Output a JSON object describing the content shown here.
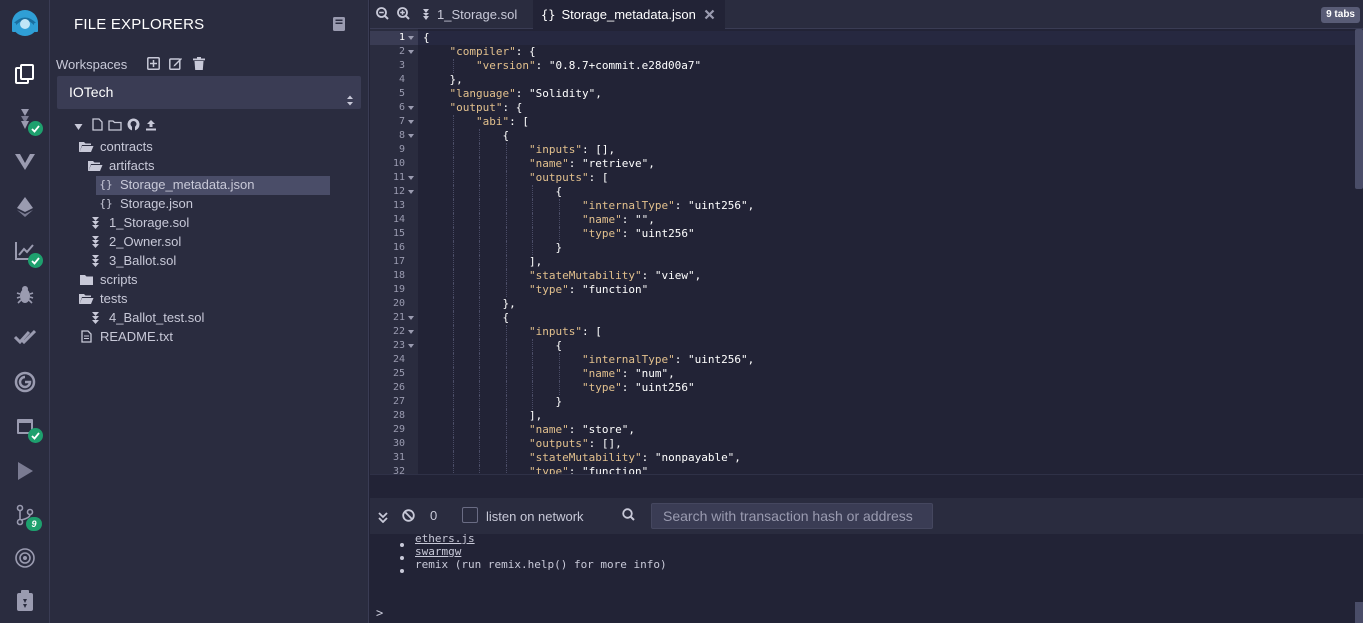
{
  "explorer": {
    "title": "FILE EXPLORERS",
    "workspaces_label": "Workspaces",
    "workspace_selected": "IOTech",
    "tree": [
      {
        "label": "contracts",
        "type": "folder-open",
        "depth": 0
      },
      {
        "label": "artifacts",
        "type": "folder-open",
        "depth": 1
      },
      {
        "label": "Storage_metadata.json",
        "type": "json",
        "depth": 2,
        "selected": true
      },
      {
        "label": "Storage.json",
        "type": "json",
        "depth": 2
      },
      {
        "label": "1_Storage.sol",
        "type": "sol",
        "depth": 1
      },
      {
        "label": "2_Owner.sol",
        "type": "sol",
        "depth": 1
      },
      {
        "label": "3_Ballot.sol",
        "type": "sol",
        "depth": 1
      },
      {
        "label": "scripts",
        "type": "folder",
        "depth": 0
      },
      {
        "label": "tests",
        "type": "folder-open",
        "depth": 0
      },
      {
        "label": "4_Ballot_test.sol",
        "type": "sol",
        "depth": 1
      },
      {
        "label": "README.txt",
        "type": "file",
        "depth": 0
      }
    ]
  },
  "iconbar": {
    "git_badge": "9"
  },
  "tabs": [
    {
      "label": "1_Storage.sol",
      "icon": "solidity-icon",
      "active": false
    },
    {
      "label": "Storage_metadata.json",
      "icon": "json-icon",
      "active": true
    }
  ],
  "tabs_count": "9 tabs",
  "code_lines": [
    {
      "n": "1",
      "fold": true,
      "ind": 0,
      "text": "{"
    },
    {
      "n": "2",
      "fold": true,
      "ind": 1,
      "k": "\"compiler\"",
      "text": ": {"
    },
    {
      "n": "3",
      "fold": false,
      "ind": 2,
      "k": "\"version\"",
      "text": ": \"0.8.7+commit.e28d00a7\""
    },
    {
      "n": "4",
      "fold": false,
      "ind": 1,
      "text": "},"
    },
    {
      "n": "5",
      "fold": false,
      "ind": 1,
      "k": "\"language\"",
      "text": ": \"Solidity\","
    },
    {
      "n": "6",
      "fold": true,
      "ind": 1,
      "k": "\"output\"",
      "text": ": {"
    },
    {
      "n": "7",
      "fold": true,
      "ind": 2,
      "k": "\"abi\"",
      "text": ": ["
    },
    {
      "n": "8",
      "fold": true,
      "ind": 3,
      "text": "{"
    },
    {
      "n": "9",
      "fold": false,
      "ind": 4,
      "k": "\"inputs\"",
      "text": ": [],"
    },
    {
      "n": "10",
      "fold": false,
      "ind": 4,
      "k": "\"name\"",
      "text": ": \"retrieve\","
    },
    {
      "n": "11",
      "fold": true,
      "ind": 4,
      "k": "\"outputs\"",
      "text": ": ["
    },
    {
      "n": "12",
      "fold": true,
      "ind": 5,
      "text": "{"
    },
    {
      "n": "13",
      "fold": false,
      "ind": 6,
      "k": "\"internalType\"",
      "text": ": \"uint256\","
    },
    {
      "n": "14",
      "fold": false,
      "ind": 6,
      "k": "\"name\"",
      "text": ": \"\","
    },
    {
      "n": "15",
      "fold": false,
      "ind": 6,
      "k": "\"type\"",
      "text": ": \"uint256\""
    },
    {
      "n": "16",
      "fold": false,
      "ind": 5,
      "text": "}"
    },
    {
      "n": "17",
      "fold": false,
      "ind": 4,
      "text": "],"
    },
    {
      "n": "18",
      "fold": false,
      "ind": 4,
      "k": "\"stateMutability\"",
      "text": ": \"view\","
    },
    {
      "n": "19",
      "fold": false,
      "ind": 4,
      "k": "\"type\"",
      "text": ": \"function\""
    },
    {
      "n": "20",
      "fold": false,
      "ind": 3,
      "text": "},"
    },
    {
      "n": "21",
      "fold": true,
      "ind": 3,
      "text": "{"
    },
    {
      "n": "22",
      "fold": true,
      "ind": 4,
      "k": "\"inputs\"",
      "text": ": ["
    },
    {
      "n": "23",
      "fold": true,
      "ind": 5,
      "text": "{"
    },
    {
      "n": "24",
      "fold": false,
      "ind": 6,
      "k": "\"internalType\"",
      "text": ": \"uint256\","
    },
    {
      "n": "25",
      "fold": false,
      "ind": 6,
      "k": "\"name\"",
      "text": ": \"num\","
    },
    {
      "n": "26",
      "fold": false,
      "ind": 6,
      "k": "\"type\"",
      "text": ": \"uint256\""
    },
    {
      "n": "27",
      "fold": false,
      "ind": 5,
      "text": "}"
    },
    {
      "n": "28",
      "fold": false,
      "ind": 4,
      "text": "],"
    },
    {
      "n": "29",
      "fold": false,
      "ind": 4,
      "k": "\"name\"",
      "text": ": \"store\","
    },
    {
      "n": "30",
      "fold": false,
      "ind": 4,
      "k": "\"outputs\"",
      "text": ": [],"
    },
    {
      "n": "31",
      "fold": false,
      "ind": 4,
      "k": "\"stateMutability\"",
      "text": ": \"nonpayable\","
    },
    {
      "n": "32",
      "fold": false,
      "ind": 4,
      "k": "\"type\"",
      "text": ": \"function\""
    }
  ],
  "terminal": {
    "tx_count": "0",
    "listen_label": "listen on network",
    "search_placeholder": "Search with transaction hash or address",
    "lines": [
      {
        "text": "ethers.js",
        "link": true
      },
      {
        "text": "swarmgw",
        "link": true
      },
      {
        "text": "remix (run remix.help() for more info)",
        "link": false
      }
    ],
    "prompt": ">"
  },
  "colors": {
    "bg": "#222336",
    "panel": "#2a2c3f",
    "accent": "#1ea06e",
    "json_key": "#e2c08d"
  }
}
